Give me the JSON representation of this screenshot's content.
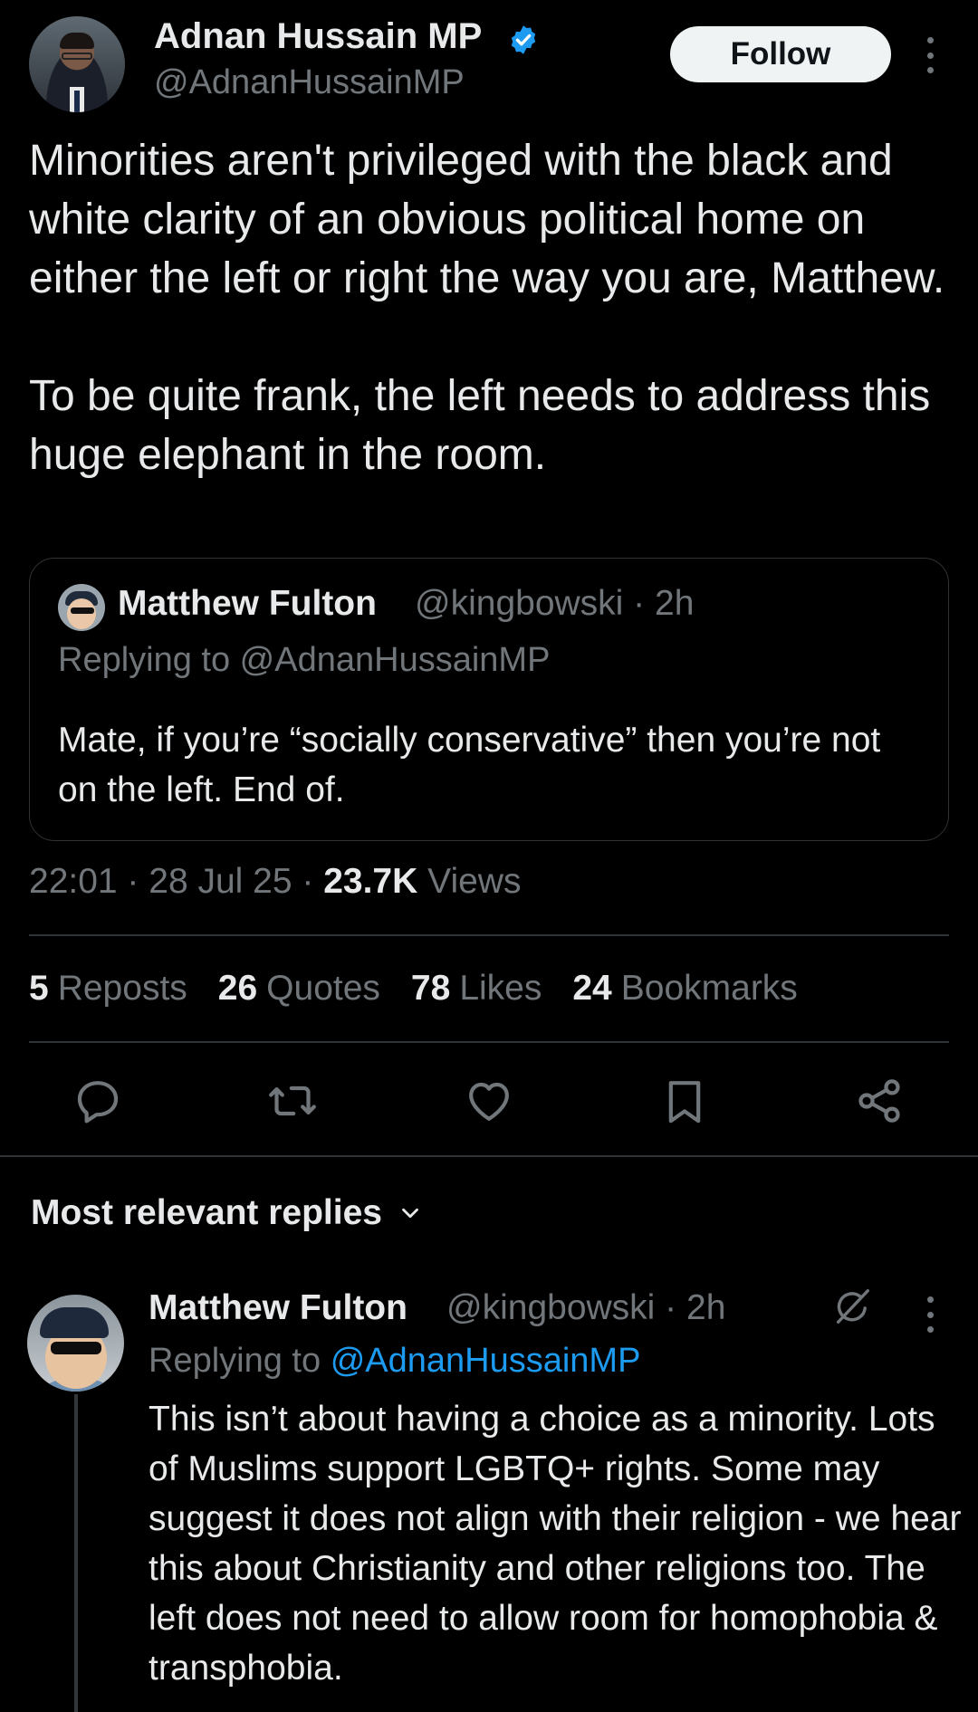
{
  "tweet": {
    "author_name": "Adnan Hussain MP",
    "author_handle": "@AdnanHussainMP",
    "follow_label": "Follow",
    "paragraphs": [
      "Minorities aren't privileged with the black and white clarity of an obvious political home on either the left or right the way you are, Matthew.",
      "To be quite frank, the left needs to address this huge elephant in the room."
    ],
    "time": "22:01 · 28 Jul 25 ·",
    "views_count": "23.7K",
    "views_label": "Views"
  },
  "quoted": {
    "author_name": "Matthew Fulton",
    "author_handle": "@kingbowski · 2h",
    "replying_to": "Replying to @AdnanHussainMP",
    "text": "Mate, if you’re “socially conservative” then you’re not on the left. End of."
  },
  "stats": {
    "reposts_count": "5",
    "reposts_label": "Reposts",
    "quotes_count": "26",
    "quotes_label": "Quotes",
    "likes_count": "78",
    "likes_label": "Likes",
    "bookmarks_count": "24",
    "bookmarks_label": "Bookmarks"
  },
  "actions": {
    "icons": [
      "reply-icon",
      "repost-icon",
      "like-icon",
      "bookmark-icon",
      "share-icon"
    ]
  },
  "replies_header": "Most relevant replies",
  "reply": {
    "author_name": "Matthew Fulton",
    "author_handle": "@kingbowski · 2h",
    "replying_prefix": "Replying to",
    "replying_mention": "@AdnanHussainMP",
    "text": "This isn’t about having a choice as a minority. Lots of Muslims support LGBTQ+ rights. Some may suggest it does not align with their religion - we hear this about Christianity and other religions too. The left does not need to allow room for homophobia & transphobia."
  },
  "colors": {
    "background": "#000000",
    "text_primary": "#e7e9ea",
    "text_secondary": "#71767b",
    "accent": "#1d9bf0",
    "border": "#2f3336"
  }
}
